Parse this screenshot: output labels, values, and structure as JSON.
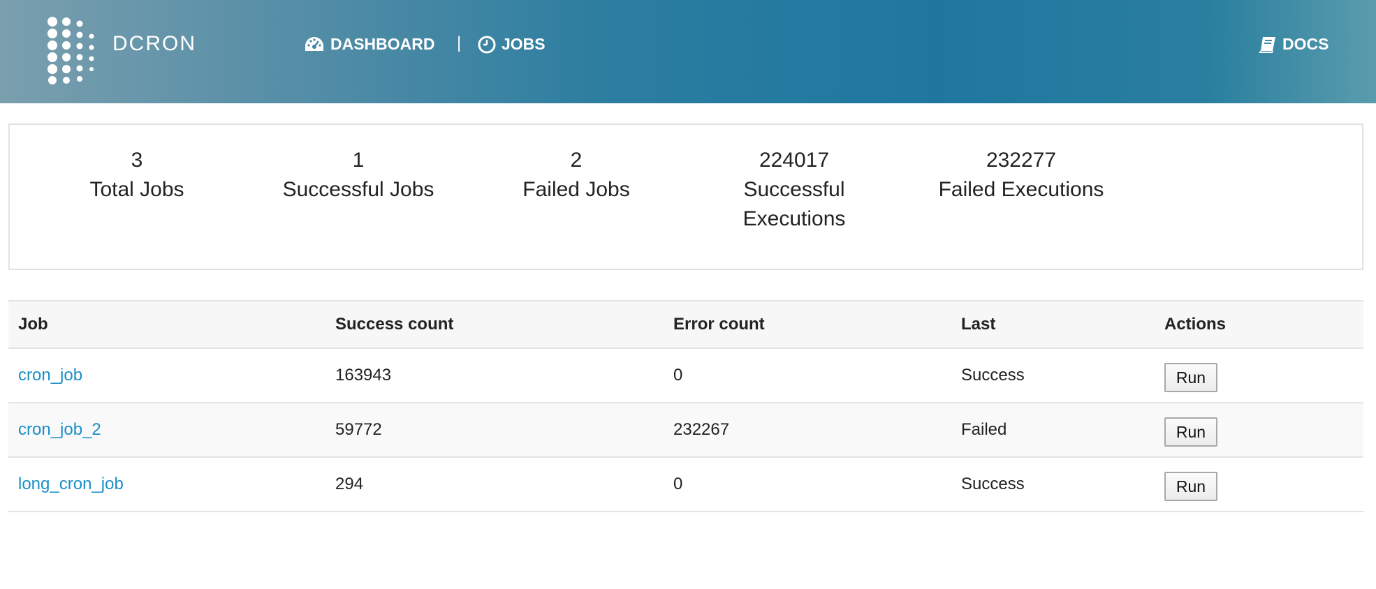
{
  "brand": {
    "name": "DCRON"
  },
  "nav": {
    "dashboard_label": "DASHBOARD",
    "separator": "|",
    "jobs_label": "JOBS",
    "docs_label": "DOCS"
  },
  "stats": [
    {
      "value": "3",
      "label": "Total Jobs"
    },
    {
      "value": "1",
      "label": "Successful Jobs"
    },
    {
      "value": "2",
      "label": "Failed Jobs"
    },
    {
      "value": "224017",
      "label": "Successful Executions"
    },
    {
      "value": "232277",
      "label": "Failed Executions"
    }
  ],
  "table": {
    "columns": [
      "Job",
      "Success count",
      "Error count",
      "Last",
      "Actions"
    ],
    "rows": [
      {
        "job": "cron_job",
        "success_count": "163943",
        "error_count": "0",
        "last": "Success",
        "action": "Run"
      },
      {
        "job": "cron_job_2",
        "success_count": "59772",
        "error_count": "232267",
        "last": "Failed",
        "action": "Run"
      },
      {
        "job": "long_cron_job",
        "success_count": "294",
        "error_count": "0",
        "last": "Success",
        "action": "Run"
      }
    ]
  },
  "icons": {
    "logo": "dot-grid-logo-icon",
    "dashboard": "dashboard-gauge-icon",
    "jobs": "clock-icon",
    "docs": "book-icon"
  },
  "colors": {
    "header_gradient_start": "#7a9fae",
    "header_gradient_mid": "#1f77a0",
    "link": "#1a8fc7"
  }
}
